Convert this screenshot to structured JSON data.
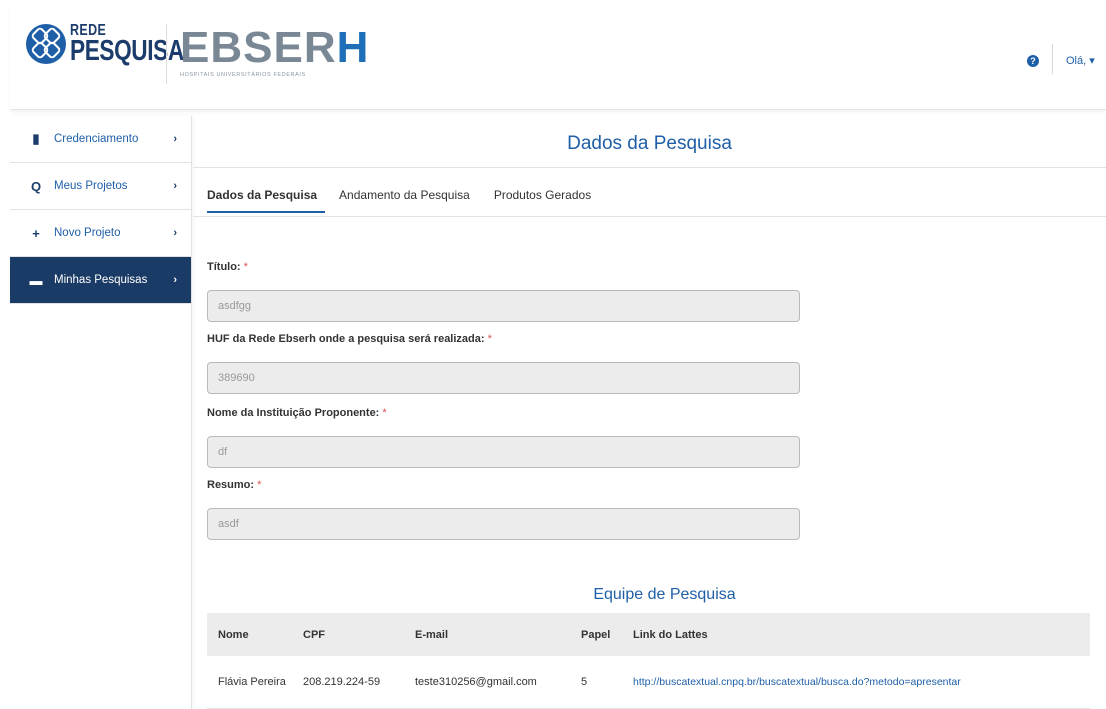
{
  "header": {
    "logo_rede": "REDE",
    "logo_pesquisa": "PESQUISA",
    "logo_ebserh": "EBSER",
    "logo_ebserh_h": "H",
    "logo_ebserh_tagline": "HOSPITAIS UNIVERSITÁRIOS FEDERAIS",
    "help_icon": "?",
    "user_menu": "Olá, ▾"
  },
  "sidebar": {
    "items": [
      {
        "label": "Credenciamento",
        "icon": "clipboard-icon",
        "glyph": "▮"
      },
      {
        "label": "Meus Projetos",
        "icon": "search-icon",
        "glyph": "Q"
      },
      {
        "label": "Novo Projeto",
        "icon": "plus-icon",
        "glyph": "+"
      },
      {
        "label": "Minhas Pesquisas",
        "icon": "folder-open-icon",
        "glyph": "▬"
      }
    ],
    "chevron": "›"
  },
  "main": {
    "title": "Dados da Pesquisa",
    "tabs": [
      {
        "label": "Dados da Pesquisa"
      },
      {
        "label": "Andamento da Pesquisa"
      },
      {
        "label": "Produtos Gerados"
      }
    ],
    "fields": [
      {
        "label": "Título:",
        "value": "asdfgg"
      },
      {
        "label": "HUF da Rede Ebserh onde a pesquisa será realizada:",
        "value": "389690"
      },
      {
        "label": "Nome da Instituição Proponente:",
        "value": "df"
      },
      {
        "label": "Resumo:",
        "value": "asdf"
      }
    ],
    "required_mark": "*"
  },
  "team": {
    "title": "Equipe de Pesquisa",
    "columns": [
      "Nome",
      "CPF",
      "E-mail",
      "Papel",
      "Link do Lattes"
    ],
    "rows": [
      {
        "nome": "Flávia Pereira",
        "cpf": "208.219.224-59",
        "email": "teste310256@gmail.com",
        "papel": "5",
        "lattes": "http://buscatextual.cnpq.br/buscatextual/busca.do?metodo=apresentar"
      }
    ]
  }
}
